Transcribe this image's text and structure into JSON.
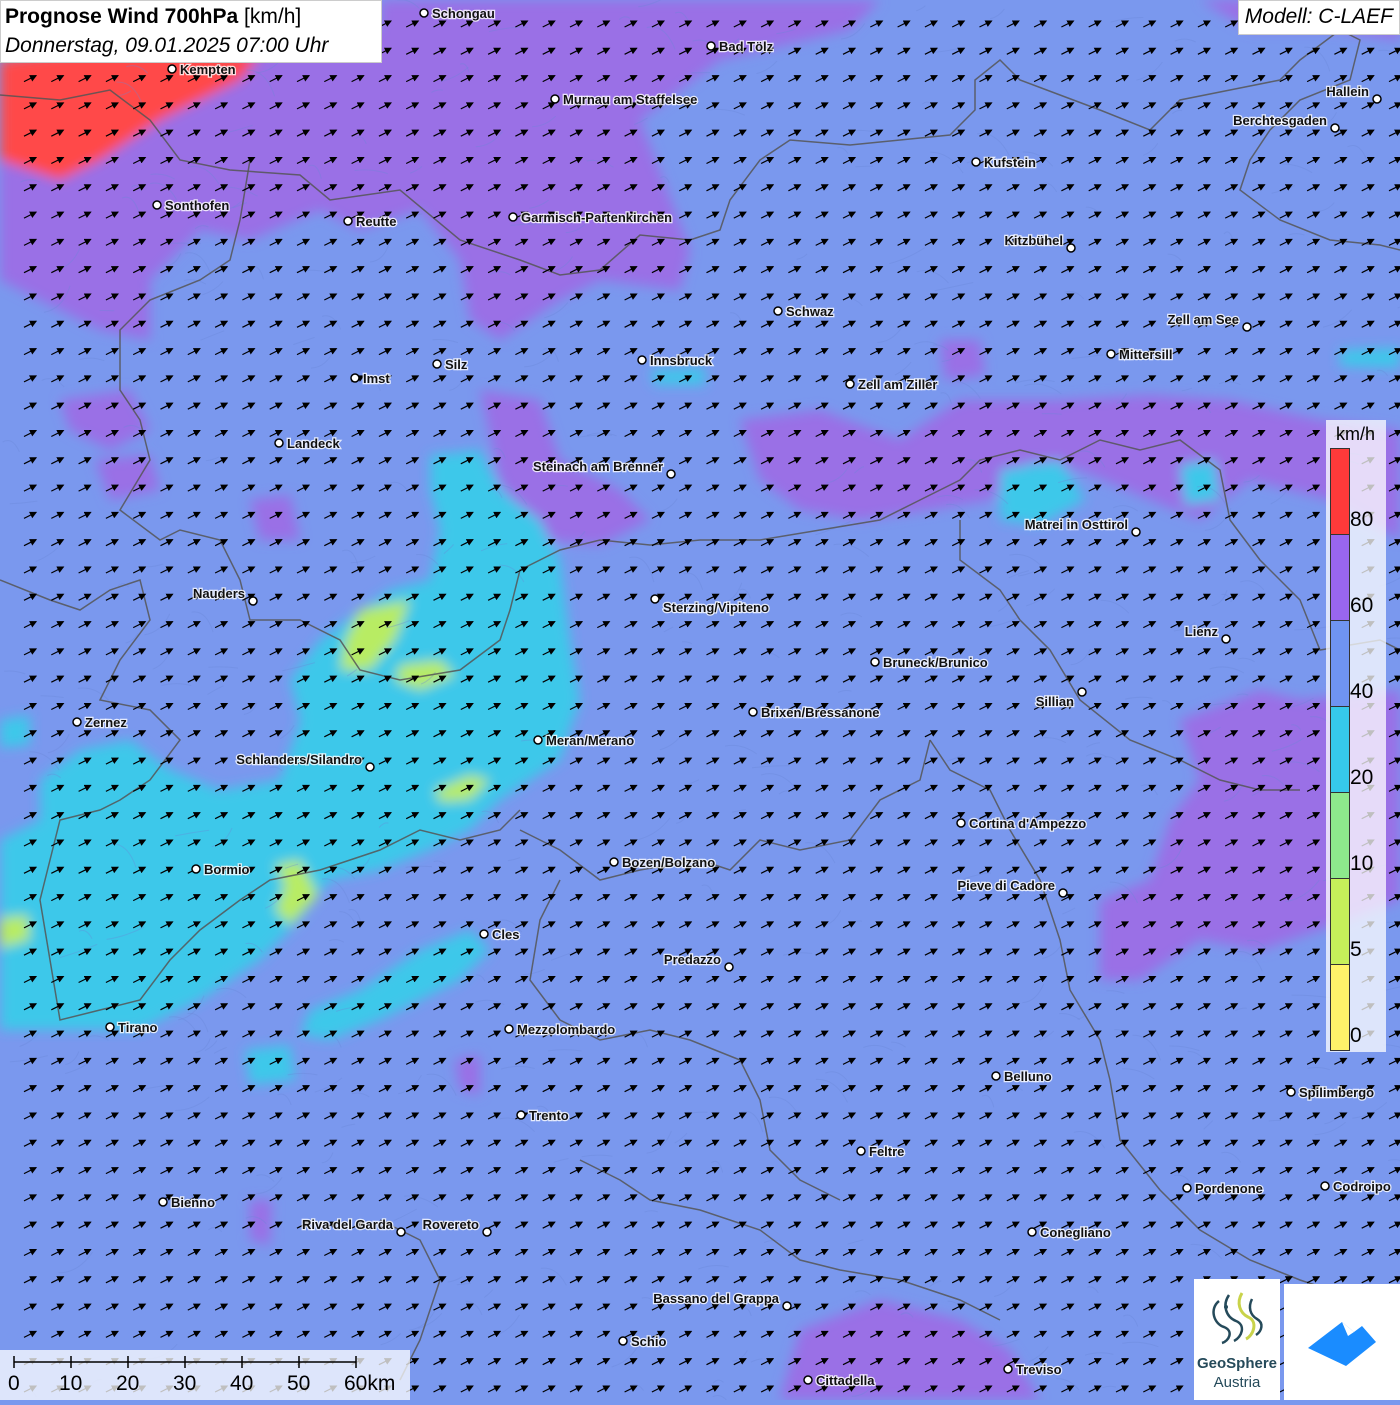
{
  "header": {
    "title_bold": "Prognose Wind 700hPa",
    "title_unit": "[km/h]",
    "datetime": "Donnerstag, 09.01.2025 07:00 Uhr"
  },
  "model_label": "Modell: C-LAEF",
  "legend": {
    "unit": "km/h",
    "bins": [
      {
        "label": "80",
        "color": "#ff3a3a"
      },
      {
        "label": "60",
        "color": "#9966ee"
      },
      {
        "label": "40",
        "color": "#6f94f2"
      },
      {
        "label": "20",
        "color": "#36c8ea"
      },
      {
        "label": "10",
        "color": "#8ee88c"
      },
      {
        "label": "5",
        "color": "#c6f05a"
      },
      {
        "label": "0",
        "color": "#fff36a"
      }
    ]
  },
  "scale_bar": {
    "labels": [
      "0",
      "10",
      "20",
      "30",
      "40",
      "50",
      "60km"
    ]
  },
  "logos": {
    "geosphere_line1": "GeoSphere",
    "geosphere_line2": "Austria"
  },
  "places": [
    {
      "name": "Schongau"
    },
    {
      "name": "Bad Tölz"
    },
    {
      "name": "Kempten"
    },
    {
      "name": "Murnau am Staffelsee"
    },
    {
      "name": "Hallein"
    },
    {
      "name": "Berchtesgaden"
    },
    {
      "name": "Kufstein"
    },
    {
      "name": "Sonthofen"
    },
    {
      "name": "Reutte"
    },
    {
      "name": "Garmisch-Partenkirchen"
    },
    {
      "name": "Kitzbühel"
    },
    {
      "name": "Schwaz"
    },
    {
      "name": "Zell am See"
    },
    {
      "name": "Mittersill"
    },
    {
      "name": "Innsbruck"
    },
    {
      "name": "Silz"
    },
    {
      "name": "Imst"
    },
    {
      "name": "Zell am Ziller"
    },
    {
      "name": "Landeck"
    },
    {
      "name": "Steinach am Brenner"
    },
    {
      "name": "Matrei in Osttirol"
    },
    {
      "name": "Nauders"
    },
    {
      "name": "Sterzing/Vipiteno"
    },
    {
      "name": "Lienz"
    },
    {
      "name": "Bruneck/Brunico"
    },
    {
      "name": "Sillian"
    },
    {
      "name": "Zernez"
    },
    {
      "name": "Brixen/Bressanone"
    },
    {
      "name": "Meran/Merano"
    },
    {
      "name": "Schlanders/Silandro"
    },
    {
      "name": "Cortina d'Ampezzo"
    },
    {
      "name": "Bozen/Bolzano"
    },
    {
      "name": "Bormio"
    },
    {
      "name": "Pieve di Cadore"
    },
    {
      "name": "Cles"
    },
    {
      "name": "Predazzo"
    },
    {
      "name": "Tirano"
    },
    {
      "name": "Mezzolombardo"
    },
    {
      "name": "Belluno"
    },
    {
      "name": "Spilimbergo"
    },
    {
      "name": "Trento"
    },
    {
      "name": "Feltre"
    },
    {
      "name": "Pordenone"
    },
    {
      "name": "Codroipo"
    },
    {
      "name": "Bienno"
    },
    {
      "name": "Riva del Garda"
    },
    {
      "name": "Rovereto"
    },
    {
      "name": "Conegliano"
    },
    {
      "name": "Bassano del Grappa"
    },
    {
      "name": "Schio"
    },
    {
      "name": "Treviso"
    },
    {
      "name": "Cittadella"
    }
  ]
}
